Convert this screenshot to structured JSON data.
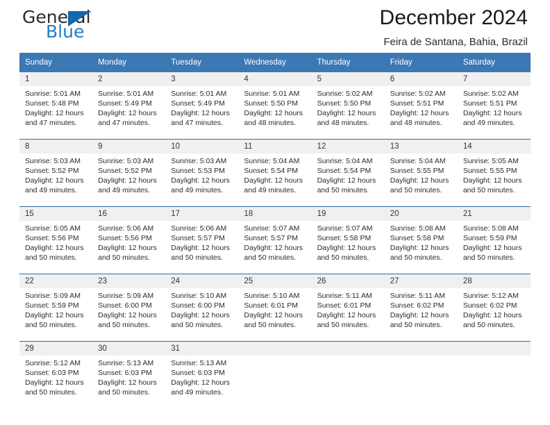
{
  "brand": {
    "name_part1": "General",
    "name_part2": "Blue",
    "triangle_icon": "triangle-icon",
    "color_dark": "#2b2b2b",
    "color_blue": "#1f7fc4"
  },
  "header": {
    "title": "December 2024",
    "subtitle": "Feira de Santana, Bahia, Brazil"
  },
  "theme": {
    "header_bar": "#3b78b4",
    "row_separator": "#2f6ca8",
    "daynum_band": "#f0f0f0",
    "text": "#2b2b2b"
  },
  "weekdays": [
    "Sunday",
    "Monday",
    "Tuesday",
    "Wednesday",
    "Thursday",
    "Friday",
    "Saturday"
  ],
  "weeks": [
    [
      {
        "day": "1",
        "sunrise": "Sunrise: 5:01 AM",
        "sunset": "Sunset: 5:48 PM",
        "daylight1": "Daylight: 12 hours",
        "daylight2": "and 47 minutes."
      },
      {
        "day": "2",
        "sunrise": "Sunrise: 5:01 AM",
        "sunset": "Sunset: 5:49 PM",
        "daylight1": "Daylight: 12 hours",
        "daylight2": "and 47 minutes."
      },
      {
        "day": "3",
        "sunrise": "Sunrise: 5:01 AM",
        "sunset": "Sunset: 5:49 PM",
        "daylight1": "Daylight: 12 hours",
        "daylight2": "and 47 minutes."
      },
      {
        "day": "4",
        "sunrise": "Sunrise: 5:01 AM",
        "sunset": "Sunset: 5:50 PM",
        "daylight1": "Daylight: 12 hours",
        "daylight2": "and 48 minutes."
      },
      {
        "day": "5",
        "sunrise": "Sunrise: 5:02 AM",
        "sunset": "Sunset: 5:50 PM",
        "daylight1": "Daylight: 12 hours",
        "daylight2": "and 48 minutes."
      },
      {
        "day": "6",
        "sunrise": "Sunrise: 5:02 AM",
        "sunset": "Sunset: 5:51 PM",
        "daylight1": "Daylight: 12 hours",
        "daylight2": "and 48 minutes."
      },
      {
        "day": "7",
        "sunrise": "Sunrise: 5:02 AM",
        "sunset": "Sunset: 5:51 PM",
        "daylight1": "Daylight: 12 hours",
        "daylight2": "and 49 minutes."
      }
    ],
    [
      {
        "day": "8",
        "sunrise": "Sunrise: 5:03 AM",
        "sunset": "Sunset: 5:52 PM",
        "daylight1": "Daylight: 12 hours",
        "daylight2": "and 49 minutes."
      },
      {
        "day": "9",
        "sunrise": "Sunrise: 5:03 AM",
        "sunset": "Sunset: 5:52 PM",
        "daylight1": "Daylight: 12 hours",
        "daylight2": "and 49 minutes."
      },
      {
        "day": "10",
        "sunrise": "Sunrise: 5:03 AM",
        "sunset": "Sunset: 5:53 PM",
        "daylight1": "Daylight: 12 hours",
        "daylight2": "and 49 minutes."
      },
      {
        "day": "11",
        "sunrise": "Sunrise: 5:04 AM",
        "sunset": "Sunset: 5:54 PM",
        "daylight1": "Daylight: 12 hours",
        "daylight2": "and 49 minutes."
      },
      {
        "day": "12",
        "sunrise": "Sunrise: 5:04 AM",
        "sunset": "Sunset: 5:54 PM",
        "daylight1": "Daylight: 12 hours",
        "daylight2": "and 50 minutes."
      },
      {
        "day": "13",
        "sunrise": "Sunrise: 5:04 AM",
        "sunset": "Sunset: 5:55 PM",
        "daylight1": "Daylight: 12 hours",
        "daylight2": "and 50 minutes."
      },
      {
        "day": "14",
        "sunrise": "Sunrise: 5:05 AM",
        "sunset": "Sunset: 5:55 PM",
        "daylight1": "Daylight: 12 hours",
        "daylight2": "and 50 minutes."
      }
    ],
    [
      {
        "day": "15",
        "sunrise": "Sunrise: 5:05 AM",
        "sunset": "Sunset: 5:56 PM",
        "daylight1": "Daylight: 12 hours",
        "daylight2": "and 50 minutes."
      },
      {
        "day": "16",
        "sunrise": "Sunrise: 5:06 AM",
        "sunset": "Sunset: 5:56 PM",
        "daylight1": "Daylight: 12 hours",
        "daylight2": "and 50 minutes."
      },
      {
        "day": "17",
        "sunrise": "Sunrise: 5:06 AM",
        "sunset": "Sunset: 5:57 PM",
        "daylight1": "Daylight: 12 hours",
        "daylight2": "and 50 minutes."
      },
      {
        "day": "18",
        "sunrise": "Sunrise: 5:07 AM",
        "sunset": "Sunset: 5:57 PM",
        "daylight1": "Daylight: 12 hours",
        "daylight2": "and 50 minutes."
      },
      {
        "day": "19",
        "sunrise": "Sunrise: 5:07 AM",
        "sunset": "Sunset: 5:58 PM",
        "daylight1": "Daylight: 12 hours",
        "daylight2": "and 50 minutes."
      },
      {
        "day": "20",
        "sunrise": "Sunrise: 5:08 AM",
        "sunset": "Sunset: 5:58 PM",
        "daylight1": "Daylight: 12 hours",
        "daylight2": "and 50 minutes."
      },
      {
        "day": "21",
        "sunrise": "Sunrise: 5:08 AM",
        "sunset": "Sunset: 5:59 PM",
        "daylight1": "Daylight: 12 hours",
        "daylight2": "and 50 minutes."
      }
    ],
    [
      {
        "day": "22",
        "sunrise": "Sunrise: 5:09 AM",
        "sunset": "Sunset: 5:59 PM",
        "daylight1": "Daylight: 12 hours",
        "daylight2": "and 50 minutes."
      },
      {
        "day": "23",
        "sunrise": "Sunrise: 5:09 AM",
        "sunset": "Sunset: 6:00 PM",
        "daylight1": "Daylight: 12 hours",
        "daylight2": "and 50 minutes."
      },
      {
        "day": "24",
        "sunrise": "Sunrise: 5:10 AM",
        "sunset": "Sunset: 6:00 PM",
        "daylight1": "Daylight: 12 hours",
        "daylight2": "and 50 minutes."
      },
      {
        "day": "25",
        "sunrise": "Sunrise: 5:10 AM",
        "sunset": "Sunset: 6:01 PM",
        "daylight1": "Daylight: 12 hours",
        "daylight2": "and 50 minutes."
      },
      {
        "day": "26",
        "sunrise": "Sunrise: 5:11 AM",
        "sunset": "Sunset: 6:01 PM",
        "daylight1": "Daylight: 12 hours",
        "daylight2": "and 50 minutes."
      },
      {
        "day": "27",
        "sunrise": "Sunrise: 5:11 AM",
        "sunset": "Sunset: 6:02 PM",
        "daylight1": "Daylight: 12 hours",
        "daylight2": "and 50 minutes."
      },
      {
        "day": "28",
        "sunrise": "Sunrise: 5:12 AM",
        "sunset": "Sunset: 6:02 PM",
        "daylight1": "Daylight: 12 hours",
        "daylight2": "and 50 minutes."
      }
    ],
    [
      {
        "day": "29",
        "sunrise": "Sunrise: 5:12 AM",
        "sunset": "Sunset: 6:03 PM",
        "daylight1": "Daylight: 12 hours",
        "daylight2": "and 50 minutes."
      },
      {
        "day": "30",
        "sunrise": "Sunrise: 5:13 AM",
        "sunset": "Sunset: 6:03 PM",
        "daylight1": "Daylight: 12 hours",
        "daylight2": "and 50 minutes."
      },
      {
        "day": "31",
        "sunrise": "Sunrise: 5:13 AM",
        "sunset": "Sunset: 6:03 PM",
        "daylight1": "Daylight: 12 hours",
        "daylight2": "and 49 minutes."
      },
      {
        "day": "",
        "sunrise": "",
        "sunset": "",
        "daylight1": "",
        "daylight2": ""
      },
      {
        "day": "",
        "sunrise": "",
        "sunset": "",
        "daylight1": "",
        "daylight2": ""
      },
      {
        "day": "",
        "sunrise": "",
        "sunset": "",
        "daylight1": "",
        "daylight2": ""
      },
      {
        "day": "",
        "sunrise": "",
        "sunset": "",
        "daylight1": "",
        "daylight2": ""
      }
    ]
  ]
}
